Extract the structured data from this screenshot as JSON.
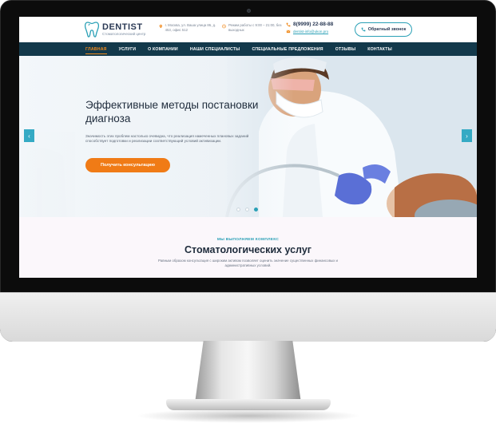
{
  "header": {
    "logo_title": "DENTIST",
    "logo_subtitle": "Стоматологический центр",
    "address": "г. Москва, ул. Ваша улица 86, д. 453, офис 512",
    "hours": "Режим работы с 9:00 – 21:00, без выходных",
    "phone": "8(9999) 22-88-88",
    "email": "dentist-info@ukon.pro",
    "callback_label": "Обратный звонок"
  },
  "nav": {
    "items": [
      "Главная",
      "Услуги",
      "О компании",
      "Наши специалисты",
      "Специальные предложения",
      "Отзывы",
      "Контакты"
    ],
    "active_index": 0
  },
  "hero": {
    "title": "Эффективные методы постановки диагноза",
    "text": "Значимость этих проблем настолько очевидна, что реализация намеченных плановых заданий способствует подготовки и реализации соответствующий условий активизации.",
    "button_label": "Получить консультацию",
    "prev_icon": "chevron-left-icon",
    "next_icon": "chevron-right-icon",
    "slides_count": 3,
    "active_slide": 2
  },
  "services": {
    "kicker": "Мы выполняем комплекс",
    "title": "Стоматологических услуг",
    "text": "Равным образом консультация с широким активом позволяет оценить значение существенных финансовых и административных условий."
  },
  "colors": {
    "accent": "#2aa0b6",
    "orange": "#f07b16",
    "nav_bg": "#13394b",
    "title": "#1e2b3b"
  }
}
